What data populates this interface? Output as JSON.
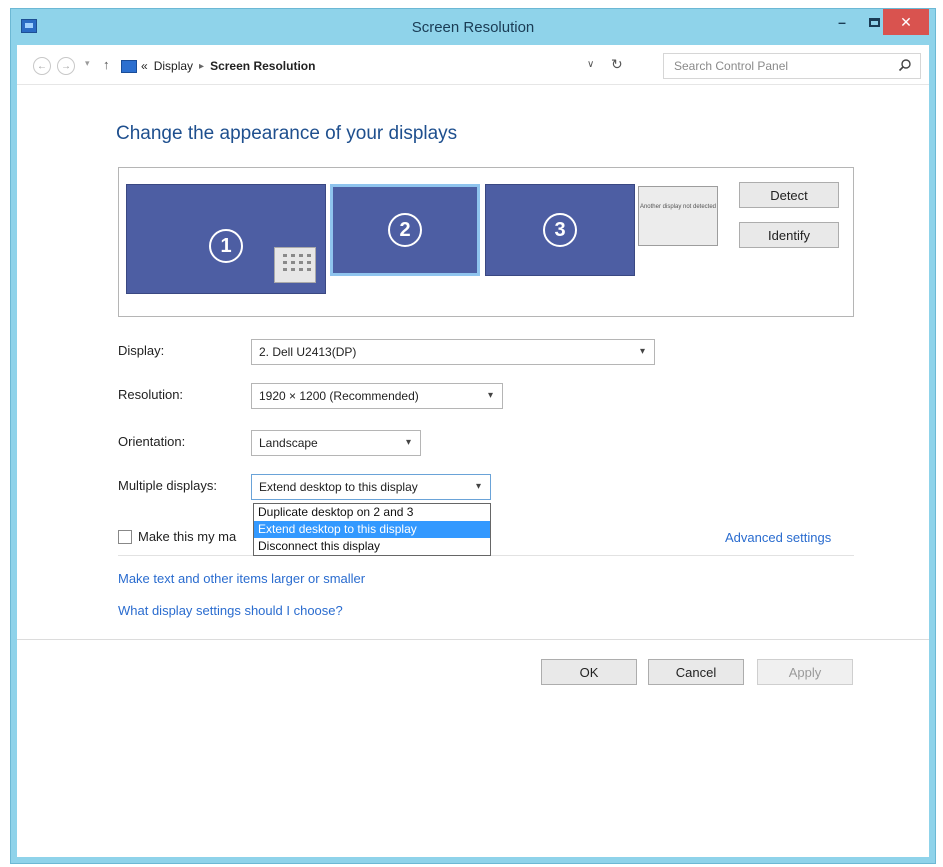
{
  "window": {
    "title": "Screen Resolution"
  },
  "address_bar": {
    "prefix": "«",
    "crumbs": [
      "Display",
      "Screen Resolution"
    ],
    "search_placeholder": "Search Control Panel"
  },
  "heading": "Change the appearance of your displays",
  "monitors": [
    {
      "number": "1"
    },
    {
      "number": "2",
      "selected": true
    },
    {
      "number": "3"
    }
  ],
  "another_display_text": "Another display not detected",
  "buttons": {
    "detect": "Detect",
    "identify": "Identify",
    "ok": "OK",
    "cancel": "Cancel",
    "apply": "Apply"
  },
  "fields": {
    "display": {
      "label": "Display:",
      "value": "2. Dell U2413(DP)"
    },
    "resolution": {
      "label": "Resolution:",
      "value": "1920 × 1200 (Recommended)"
    },
    "orientation": {
      "label": "Orientation:",
      "value": "Landscape"
    },
    "multiple": {
      "label": "Multiple displays:",
      "value": "Extend desktop to this display"
    }
  },
  "multiple_options": [
    "Duplicate desktop on 2 and 3",
    "Extend desktop to this display",
    "Disconnect this display"
  ],
  "checkbox_label": "Make this my ma",
  "links": {
    "advanced": "Advanced settings",
    "text_larger": "Make text and other items larger or smaller",
    "what_settings": "What display settings should I choose?"
  },
  "colors": {
    "accent": "#3399ff",
    "link": "#2a6ccf",
    "monitor": "#4d5ea3",
    "titlebar": "#8fd3ea"
  }
}
